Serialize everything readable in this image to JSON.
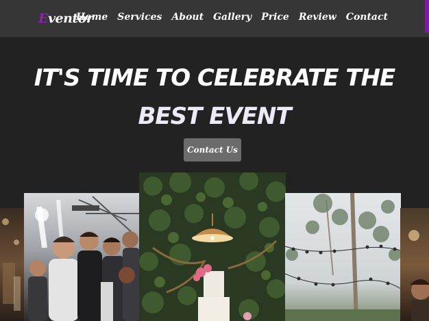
{
  "header": {
    "logo_first_letter": "E",
    "logo_rest": "ventor",
    "nav": [
      "Home",
      "Services",
      "About",
      "Gallery",
      "Price",
      "Review",
      "Contact"
    ],
    "accent_color": "#7b1fa2"
  },
  "hero": {
    "title_line1": "IT'S TIME TO CELEBRATE THE",
    "title_line2": "BEST EVENT",
    "cta_label": "Contact Us"
  },
  "gallery": {
    "photos": [
      "left-edge-photo",
      "party-sparklers-photo",
      "wedding-cake-photo",
      "outdoor-string-lights-photo",
      "right-edge-photo"
    ]
  }
}
